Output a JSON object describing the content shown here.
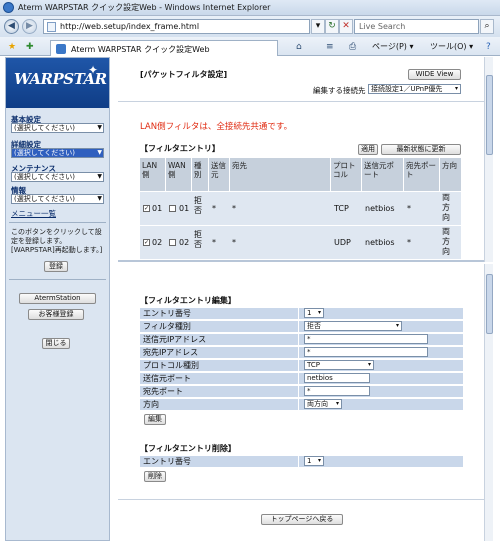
{
  "window": {
    "title": "Aterm WARPSTAR クイック設定Web - Windows Internet Explorer"
  },
  "address": {
    "url": "http://web.setup/index_frame.html",
    "search_placeholder": "Live Search"
  },
  "tab": {
    "label": "Aterm WARPSTAR クイック設定Web"
  },
  "toolbar": {
    "page_label": "ページ(P) ▾",
    "tools_label": "ツール(O) ▾"
  },
  "sidebar": {
    "logo": "WARPSTAR",
    "groups": [
      {
        "label": "基本設定",
        "value": "(選択してください)"
      },
      {
        "label": "詳細設定",
        "value": "(選択してください)"
      },
      {
        "label": "メンテナンス",
        "value": "(選択してください)"
      },
      {
        "label": "情報",
        "value": "(選択してください)"
      }
    ],
    "menu_link": "メニュー一覧",
    "note": "このボタンをクリックして設定を登録します。[WARPSTAR]再起動します。]",
    "register_btn": "登録",
    "aterm_station_btn": "AtermStation",
    "customer_btn": "お客様登録",
    "close_btn": "閉じる"
  },
  "top": {
    "title": "[パケットフィルタ設定]",
    "wide_view": "WIDE View",
    "target_label": "編集する接続先",
    "target_value": "接続設定1／UPnP優先",
    "notice": "LAN側フィルタは、全接続先共通です。",
    "entry_title": "【フィルタエントリ】",
    "apply_btn": "適用",
    "refresh_btn": "最新状態に更新",
    "columns": [
      "LAN側",
      "WAN側",
      "種別",
      "送信元",
      "宛先",
      "プロトコル",
      "送信元ポート",
      "宛先ポート",
      "方向"
    ],
    "rows": [
      {
        "lan": "01",
        "wan": "01",
        "type": "拒否",
        "src": "*",
        "dst": "*",
        "proto": "TCP",
        "sport": "netbios",
        "dport": "*",
        "dir": "両方向"
      },
      {
        "lan": "02",
        "wan": "02",
        "type": "拒否",
        "src": "*",
        "dst": "*",
        "proto": "UDP",
        "sport": "netbios",
        "dport": "*",
        "dir": "両方向"
      }
    ]
  },
  "edit": {
    "title": "【フィルタエントリ編集】",
    "fields": [
      {
        "label": "エントリ番号",
        "value": "1"
      },
      {
        "label": "フィルタ種別",
        "value": "拒否"
      },
      {
        "label": "送信元IPアドレス",
        "value": "*"
      },
      {
        "label": "宛先IPアドレス",
        "value": "*"
      },
      {
        "label": "プロトコル種別",
        "value": "TCP"
      },
      {
        "label": "送信元ポート",
        "value": "netbios"
      },
      {
        "label": "宛先ポート",
        "value": "*"
      },
      {
        "label": "方向",
        "value": "両方向"
      }
    ],
    "edit_btn": "編集",
    "delete_title": "【フィルタエントリ削除】",
    "delete_field": {
      "label": "エントリ番号",
      "value": "1"
    },
    "delete_btn": "削除",
    "top_btn": "トップページへ戻る"
  }
}
